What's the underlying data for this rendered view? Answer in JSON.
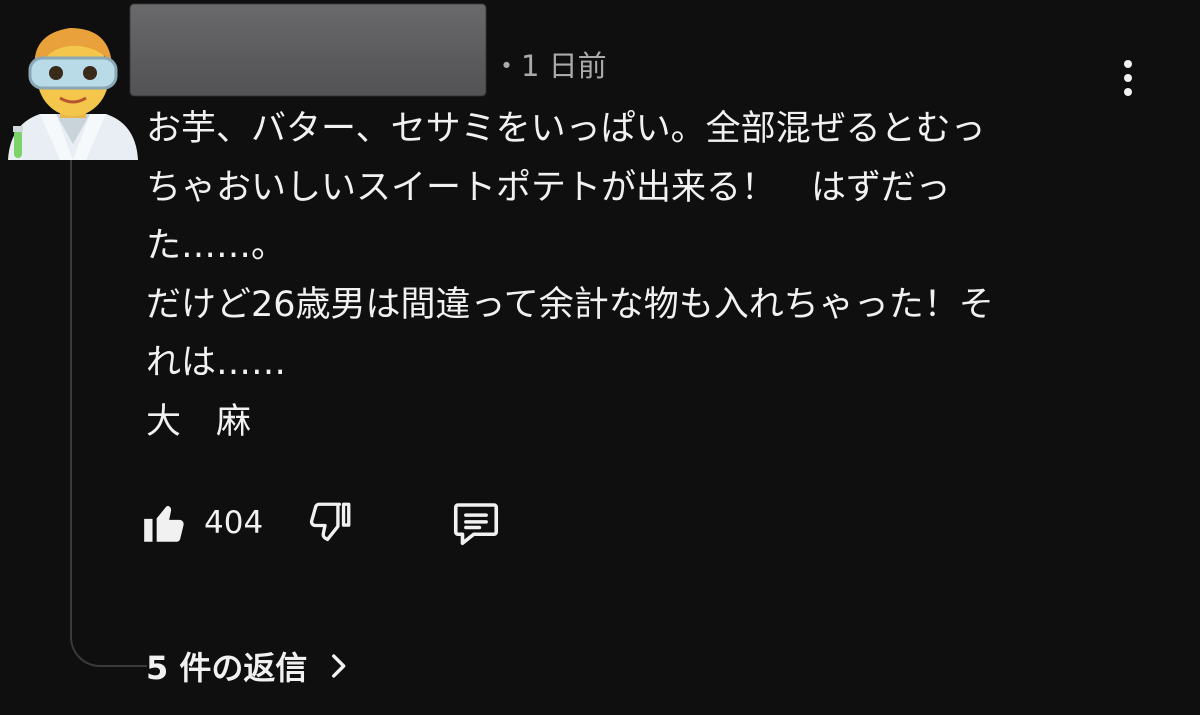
{
  "comment": {
    "author_avatar": "scientist-emoji",
    "timestamp": "・1 日前",
    "lines": [
      "お芋、バター、セサミをいっぱい。全部混ぜるとむっ",
      "ちゃおいしいスイートポテトが出来る！　はずだっ",
      "た……。",
      "だけど26歳男は間違って余計な物も入れちゃった！そ",
      "れは……",
      "大　麻"
    ],
    "like_count": "404",
    "replies_label": "5 件の返信"
  },
  "icons": {
    "menu": "more-vert-icon",
    "like": "thumbs-up-icon",
    "dislike": "thumbs-down-icon",
    "reply": "comment-icon",
    "chevron": "chevron-right-icon"
  },
  "colors": {
    "background": "#0f0f0f",
    "text": "#f1f1f1",
    "secondary_text": "#aaaaaa",
    "thread_line": "#3a3a3a"
  }
}
